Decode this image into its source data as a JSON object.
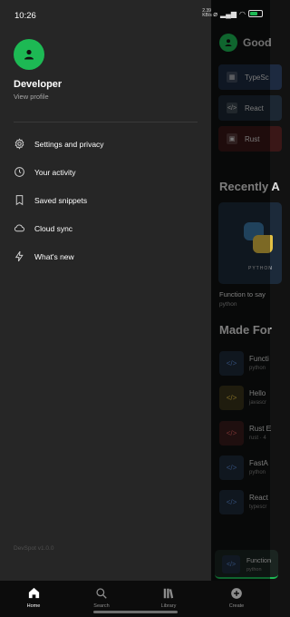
{
  "status": {
    "time": "10:26",
    "net_speed_top": "2.39",
    "net_speed_bottom": "KB/s",
    "battery_label": "battery-icon"
  },
  "background": {
    "greeting": "Good",
    "quick_items": [
      {
        "label": "TypeSc",
        "icon": "image-icon"
      },
      {
        "label": "React",
        "icon": "code-icon"
      },
      {
        "label": "Rust",
        "icon": "square-icon"
      }
    ],
    "recent_title": "Recently A",
    "card_label": "PYTHON",
    "card_title": "Function to say",
    "card_sub": "python",
    "made_for_title": "Made For",
    "rows": [
      {
        "title": "Functi",
        "sub": "python",
        "color": "#1e2a3a"
      },
      {
        "title": "Hello",
        "sub": "javascr",
        "color": "#3a331a"
      },
      {
        "title": "Rust E",
        "sub": "rust · 4",
        "color": "#3a1c1c"
      },
      {
        "title": "FastA",
        "sub": "python",
        "color": "#1e2a3a"
      },
      {
        "title": "React",
        "sub": "typescr",
        "color": "#1e2a3a"
      }
    ],
    "mini_player": {
      "title": "Function",
      "sub": "python"
    }
  },
  "drawer": {
    "profile_name": "Developer",
    "profile_link": "View profile",
    "menu": [
      {
        "label": "Settings and privacy",
        "icon": "gear-icon",
        "name": "menu-item-settings"
      },
      {
        "label": "Your activity",
        "icon": "clock-icon",
        "name": "menu-item-activity"
      },
      {
        "label": "Saved snippets",
        "icon": "bookmark-icon",
        "name": "menu-item-saved-snippets"
      },
      {
        "label": "Cloud sync",
        "icon": "cloud-icon",
        "name": "menu-item-cloud-sync"
      },
      {
        "label": "What's new",
        "icon": "bolt-icon",
        "name": "menu-item-whats-new"
      }
    ],
    "version": "DevSpot v1.0.0"
  },
  "bottom_nav": [
    {
      "label": "Home",
      "icon": "home-icon",
      "active": true
    },
    {
      "label": "Search",
      "icon": "search-icon",
      "active": false
    },
    {
      "label": "Library",
      "icon": "library-icon",
      "active": false
    },
    {
      "label": "Create",
      "icon": "plus-icon",
      "active": false
    }
  ],
  "colors": {
    "accent": "#1db954",
    "drawer_bg": "#262626",
    "nav_bg": "#0c0c0c"
  }
}
